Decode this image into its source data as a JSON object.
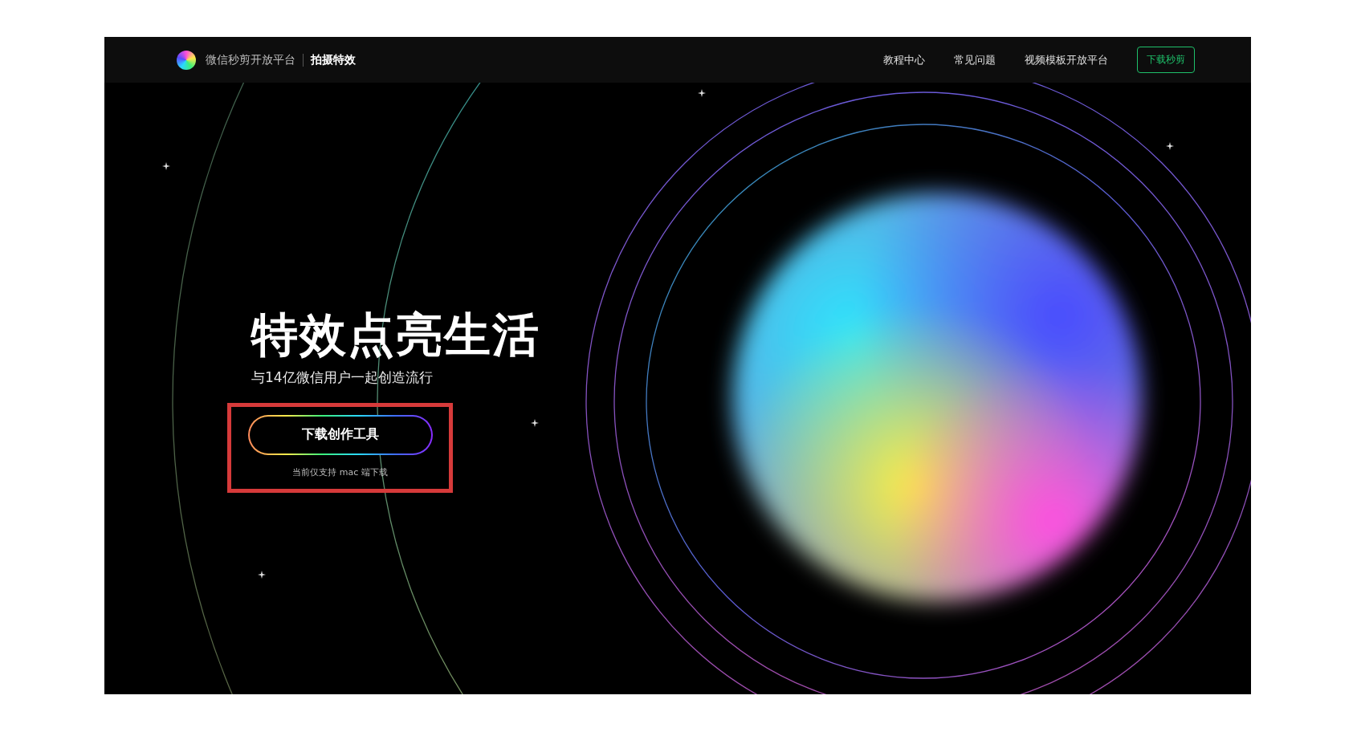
{
  "header": {
    "brand": "微信秒剪开放平台",
    "section": "拍摄特效",
    "nav": [
      "教程中心",
      "常见问题",
      "视频模板开放平台"
    ],
    "cta": "下载秒剪"
  },
  "hero": {
    "title": "特效点亮生活",
    "subtitle": "与14亿微信用户一起创造流行",
    "button": "下载创作工具",
    "note": "当前仅支持 mac 端下载"
  }
}
